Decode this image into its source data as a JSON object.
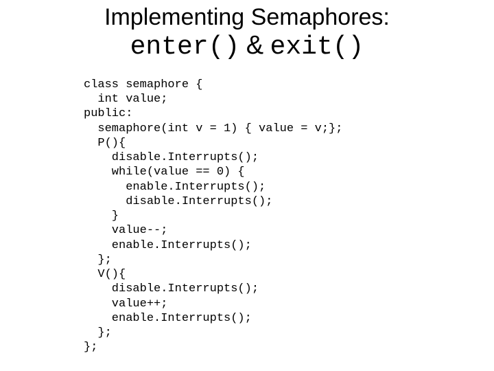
{
  "title": {
    "line1": "Implementing Semaphores:",
    "code1": "enter()",
    "amp": "&",
    "code2": "exit()"
  },
  "code": {
    "l1": "class semaphore {",
    "l2": "  int value;",
    "l3": "public:",
    "l4": "  semaphore(int v = 1) { value = v;};",
    "l5": "  P(){",
    "l6": "    disable.Interrupts();",
    "l7": "    while(value == 0) {",
    "l8": "      enable.Interrupts();",
    "l9": "      disable.Interrupts();",
    "l10": "    }",
    "l11": "    value--;",
    "l12": "    enable.Interrupts();",
    "l13": "  };",
    "l14": "  V(){",
    "l15": "    disable.Interrupts();",
    "l16": "    value++;",
    "l17": "    enable.Interrupts();",
    "l18": "  };",
    "l19": "};"
  }
}
